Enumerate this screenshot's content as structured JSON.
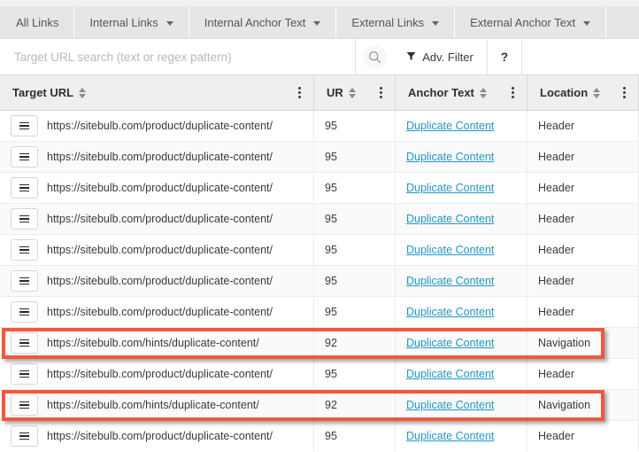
{
  "tabs": [
    {
      "label": "All Links",
      "has_caret": false
    },
    {
      "label": "Internal Links",
      "has_caret": true
    },
    {
      "label": "Internal Anchor Text",
      "has_caret": true
    },
    {
      "label": "External Links",
      "has_caret": true
    },
    {
      "label": "External Anchor Text",
      "has_caret": true
    }
  ],
  "search": {
    "value": "",
    "placeholder": "Target URL search (text or regex pattern)",
    "search_icon": "search-icon"
  },
  "toolbar": {
    "adv_filter_label": "Adv. Filter",
    "filter_icon": "funnel-icon",
    "help_label": "?"
  },
  "table": {
    "columns": [
      {
        "label": "Target URL",
        "key": "url"
      },
      {
        "label": "UR",
        "key": "ur"
      },
      {
        "label": "Anchor Text",
        "key": "anchor"
      },
      {
        "label": "Location",
        "key": "location"
      }
    ],
    "rows": [
      {
        "url": "https://sitebulb.com/product/duplicate-content/",
        "ur": "95",
        "anchor": "Duplicate Content",
        "location": "Header",
        "highlighted": false
      },
      {
        "url": "https://sitebulb.com/product/duplicate-content/",
        "ur": "95",
        "anchor": "Duplicate Content",
        "location": "Header",
        "highlighted": false
      },
      {
        "url": "https://sitebulb.com/product/duplicate-content/",
        "ur": "95",
        "anchor": "Duplicate Content",
        "location": "Header",
        "highlighted": false
      },
      {
        "url": "https://sitebulb.com/product/duplicate-content/",
        "ur": "95",
        "anchor": "Duplicate Content",
        "location": "Header",
        "highlighted": false
      },
      {
        "url": "https://sitebulb.com/product/duplicate-content/",
        "ur": "95",
        "anchor": "Duplicate Content",
        "location": "Header",
        "highlighted": false
      },
      {
        "url": "https://sitebulb.com/product/duplicate-content/",
        "ur": "95",
        "anchor": "Duplicate Content",
        "location": "Header",
        "highlighted": false
      },
      {
        "url": "https://sitebulb.com/product/duplicate-content/",
        "ur": "95",
        "anchor": "Duplicate Content",
        "location": "Header",
        "highlighted": false
      },
      {
        "url": "https://sitebulb.com/hints/duplicate-content/",
        "ur": "92",
        "anchor": "Duplicate Content",
        "location": "Navigation",
        "highlighted": true
      },
      {
        "url": "https://sitebulb.com/product/duplicate-content/",
        "ur": "95",
        "anchor": "Duplicate Content",
        "location": "Header",
        "highlighted": false
      },
      {
        "url": "https://sitebulb.com/hints/duplicate-content/",
        "ur": "92",
        "anchor": "Duplicate Content",
        "location": "Navigation",
        "highlighted": true
      },
      {
        "url": "https://sitebulb.com/product/duplicate-content/",
        "ur": "95",
        "anchor": "Duplicate Content",
        "location": "Header",
        "highlighted": false
      }
    ]
  },
  "colors": {
    "highlight": "#f4573c",
    "link": "#2196c4",
    "tab_bg": "#e6e6e6",
    "header_bg": "#efefef"
  }
}
